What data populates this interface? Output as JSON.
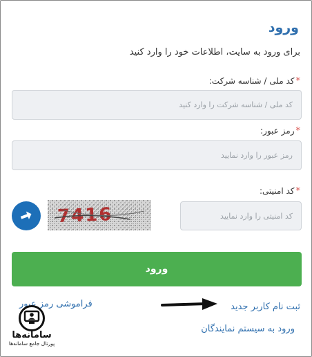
{
  "form": {
    "title": "ورود",
    "subtitle": "برای ورود به سایت، اطلاعات خود را وارد کنید",
    "required_mark": "*",
    "national_id": {
      "label": "کد ملی / شناسه شرکت:",
      "placeholder": "کد ملی / شناسه شرکت را وارد کنید",
      "value": ""
    },
    "password": {
      "label": "رمز عبور:",
      "placeholder": "رمز عبور را وارد نمایید",
      "value": ""
    },
    "captcha": {
      "label": "کد امنیتی:",
      "placeholder": "کد امنیتی را وارد نمایید",
      "value": "",
      "image_text": "7416"
    },
    "submit_label": "ورود",
    "links": {
      "forgot_password": "فراموشی رمز عبور",
      "register": "ثبت نام کاربر جدید",
      "agents_login": "ورود به سیستم نمایندگان"
    }
  },
  "watermark": {
    "brand": "سامانه‌ها",
    "tagline": "پورتال جامع سامانه‌ها"
  },
  "colors": {
    "accent": "#2f6fae",
    "submit": "#4caf50",
    "required": "#d9534f",
    "refresh_button": "#1d6fb8"
  },
  "icons": {
    "refresh": "refresh-icon",
    "arrow": "arrow-right-icon",
    "logo": "monitor-user-icon"
  }
}
